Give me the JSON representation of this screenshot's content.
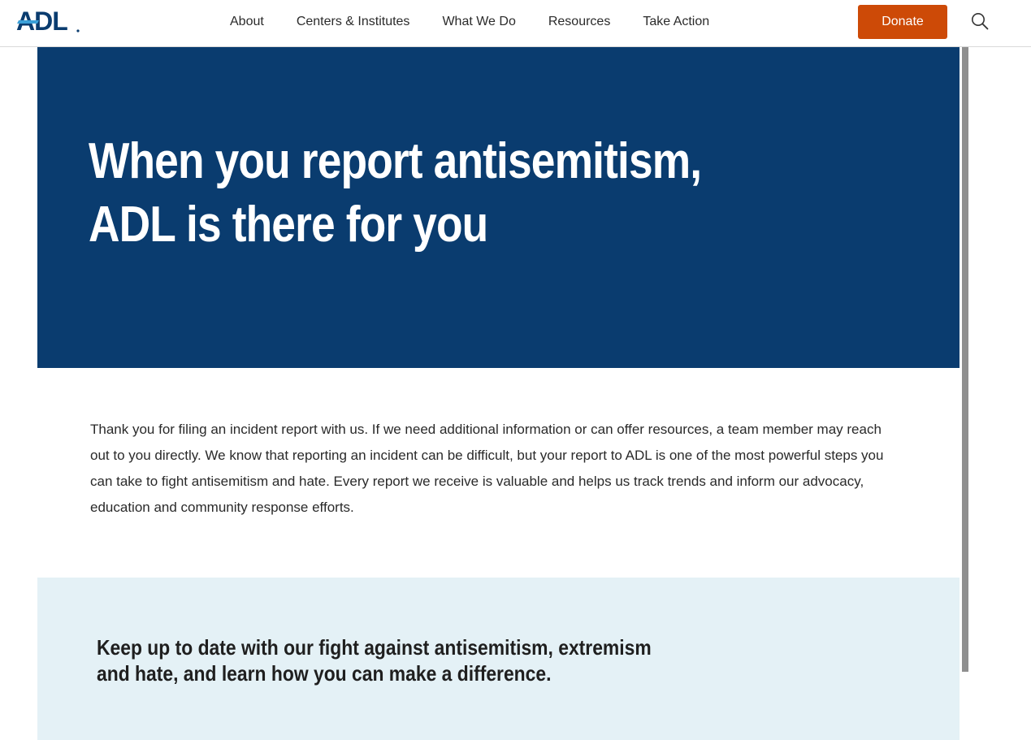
{
  "brand": {
    "logo_text": "ADL",
    "primary_color": "#0a3c6f",
    "accent_color": "#cd4a07",
    "logo_accent_color": "#3aa0d8"
  },
  "nav": {
    "items": [
      {
        "label": "About"
      },
      {
        "label": "Centers & Institutes"
      },
      {
        "label": "What We Do"
      },
      {
        "label": "Resources"
      },
      {
        "label": "Take Action"
      }
    ]
  },
  "header": {
    "donate_label": "Donate",
    "search_icon": "search-icon"
  },
  "hero": {
    "title": "When you report antisemitism, ADL is there for you"
  },
  "body": {
    "thank_you_text": "Thank you for filing an incident report with us. If we need additional information or can offer resources, a team member may reach out to you directly. We know that reporting an incident can be difficult, but your report to ADL is one of the most powerful steps you can take to fight antisemitism and hate. Every report we receive is valuable and helps us track trends and inform our advocacy, education and community response efforts."
  },
  "newsletter": {
    "heading": "Keep up to date with our fight against antisemitism, extremism and hate, and learn how you can make a difference."
  }
}
